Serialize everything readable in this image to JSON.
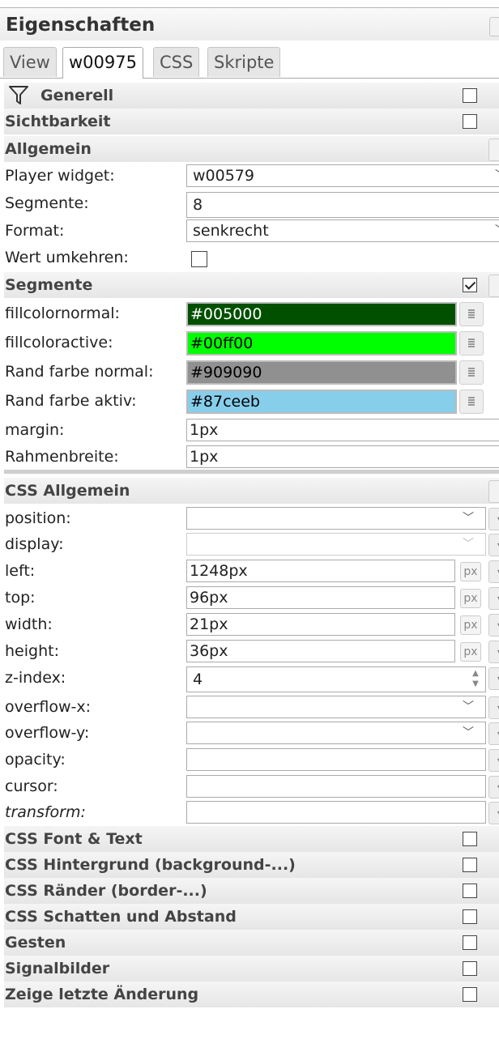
{
  "window": {
    "title": "Eigenschaften"
  },
  "tabs": [
    "View",
    "w00975",
    "CSS",
    "Skripte"
  ],
  "sections": {
    "generell": "Generell",
    "sichtbarkeit": "Sichtbarkeit",
    "allgemein": "Allgemein",
    "segmente": "Segmente",
    "css_allgemein": "CSS Allgemein",
    "css_font": "CSS Font & Text",
    "css_hintergrund": "CSS Hintergrund (background-...)",
    "css_raender": "CSS Ränder (border-...)",
    "css_schatten": "CSS Schatten und Abstand",
    "gesten": "Gesten",
    "signalbilder": "Signalbilder",
    "letzte_aenderung": "Zeige letzte Änderung"
  },
  "allgemein": {
    "player_widget": {
      "label": "Player widget:",
      "value": "w00579"
    },
    "segmente": {
      "label": "Segmente:",
      "value": "8"
    },
    "format": {
      "label": "Format:",
      "value": "senkrecht"
    },
    "wert_umkehren": {
      "label": "Wert umkehren:",
      "checked": false
    }
  },
  "segmente": {
    "fillcolornormal": {
      "label": "fillcolornormal:",
      "value": "#005000",
      "bg": "#005000",
      "fg": "#ffffff"
    },
    "fillcoloractive": {
      "label": "fillcoloractive:",
      "value": "#00ff00",
      "bg": "#00ff00",
      "fg": "#000000"
    },
    "rand_normal": {
      "label": "Rand farbe normal:",
      "value": "#909090",
      "bg": "#909090",
      "fg": "#000000"
    },
    "rand_aktiv": {
      "label": "Rand farbe aktiv:",
      "value": "#87ceeb",
      "bg": "#87ceeb",
      "fg": "#000000"
    },
    "margin": {
      "label": "margin:",
      "value": "1px"
    },
    "rahmenbreite": {
      "label": "Rahmenbreite:",
      "value": "1px"
    }
  },
  "css": {
    "position": {
      "label": "position:",
      "value": ""
    },
    "display": {
      "label": "display:",
      "value": ""
    },
    "left": {
      "label": "left:",
      "value": "1248px",
      "unit": "px"
    },
    "top": {
      "label": "top:",
      "value": "96px",
      "unit": "px"
    },
    "width": {
      "label": "width:",
      "value": "21px",
      "unit": "px"
    },
    "height": {
      "label": "height:",
      "value": "36px",
      "unit": "px"
    },
    "zindex": {
      "label": "z-index:",
      "value": "4"
    },
    "overflow_x": {
      "label": "overflow-x:",
      "value": ""
    },
    "overflow_y": {
      "label": "overflow-y:",
      "value": ""
    },
    "opacity": {
      "label": "opacity:",
      "value": ""
    },
    "cursor": {
      "label": "cursor:",
      "value": ""
    },
    "transform": {
      "label": "transform:",
      "value": ""
    }
  },
  "icons": {
    "funnel": "filter-funnel-icon",
    "chevron": "chevron-down-icon",
    "color_picker": "color-picker-icon"
  }
}
